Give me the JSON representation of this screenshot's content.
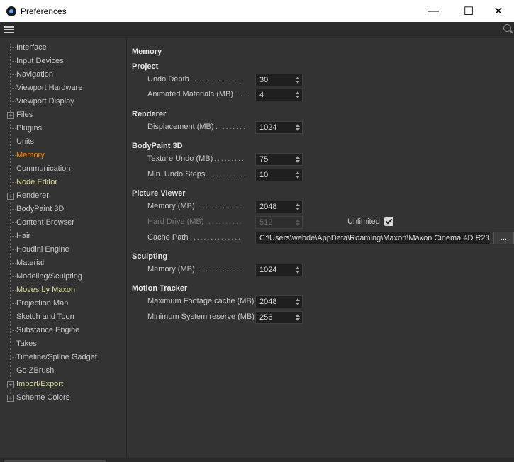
{
  "window": {
    "title": "Preferences",
    "minimize": "—",
    "maximize": "☐",
    "close": "✕"
  },
  "sidebar": {
    "items": [
      {
        "label": "Interface",
        "state": "normal",
        "expandable": false
      },
      {
        "label": "Input Devices",
        "state": "normal",
        "expandable": false
      },
      {
        "label": "Navigation",
        "state": "normal",
        "expandable": false
      },
      {
        "label": "Viewport Hardware",
        "state": "normal",
        "expandable": false
      },
      {
        "label": "Viewport Display",
        "state": "normal",
        "expandable": false
      },
      {
        "label": "Files",
        "state": "normal",
        "expandable": true
      },
      {
        "label": "Plugins",
        "state": "normal",
        "expandable": false
      },
      {
        "label": "Units",
        "state": "normal",
        "expandable": false
      },
      {
        "label": "Memory",
        "state": "active",
        "expandable": false
      },
      {
        "label": "Communication",
        "state": "normal",
        "expandable": false
      },
      {
        "label": "Node Editor",
        "state": "plugin",
        "expandable": false
      },
      {
        "label": "Renderer",
        "state": "normal",
        "expandable": true
      },
      {
        "label": "BodyPaint 3D",
        "state": "normal",
        "expandable": false
      },
      {
        "label": "Content Browser",
        "state": "normal",
        "expandable": false
      },
      {
        "label": "Hair",
        "state": "normal",
        "expandable": false
      },
      {
        "label": "Houdini Engine",
        "state": "normal",
        "expandable": false
      },
      {
        "label": "Material",
        "state": "normal",
        "expandable": false
      },
      {
        "label": "Modeling/Sculpting",
        "state": "normal",
        "expandable": false
      },
      {
        "label": "Moves by Maxon",
        "state": "plugin",
        "expandable": false
      },
      {
        "label": "Projection Man",
        "state": "normal",
        "expandable": false
      },
      {
        "label": "Sketch and Toon",
        "state": "normal",
        "expandable": false
      },
      {
        "label": "Substance Engine",
        "state": "normal",
        "expandable": false
      },
      {
        "label": "Takes",
        "state": "normal",
        "expandable": false
      },
      {
        "label": "Timeline/Spline Gadget",
        "state": "normal",
        "expandable": false
      },
      {
        "label": "Go ZBrush",
        "state": "normal",
        "expandable": false
      },
      {
        "label": "Import/Export",
        "state": "plugin",
        "expandable": true
      },
      {
        "label": "Scheme Colors",
        "state": "normal",
        "expandable": true
      }
    ]
  },
  "main": {
    "page_title": "Memory",
    "sections": {
      "project": {
        "heading": "Project",
        "undo_depth": {
          "label": "Undo Depth",
          "value": "30"
        },
        "animated_materials": {
          "label": "Animated Materials (MB)",
          "value": "4"
        }
      },
      "renderer": {
        "heading": "Renderer",
        "displacement": {
          "label": "Displacement (MB)",
          "value": "1024"
        }
      },
      "bodypaint": {
        "heading": "BodyPaint 3D",
        "texture_undo": {
          "label": "Texture Undo (MB)",
          "value": "75"
        },
        "min_undo_steps": {
          "label": "Min. Undo Steps.",
          "value": "10"
        }
      },
      "picture_viewer": {
        "heading": "Picture Viewer",
        "memory": {
          "label": "Memory (MB)",
          "value": "2048"
        },
        "hard_drive": {
          "label": "Hard Drive (MB)",
          "value": "512"
        },
        "unlimited_label": "Unlimited",
        "unlimited_checked": true,
        "cache_path": {
          "label": "Cache Path",
          "value": "C:\\Users\\webde\\AppData\\Roaming\\Maxon\\Maxon Cinema 4D R23",
          "browse": "..."
        }
      },
      "sculpting": {
        "heading": "Sculpting",
        "memory": {
          "label": "Memory (MB)",
          "value": "1024"
        }
      },
      "motion_tracker": {
        "heading": "Motion Tracker",
        "max_footage": {
          "label": "Maximum Footage cache (MB)",
          "value": "2048"
        },
        "min_system": {
          "label": "Minimum System reserve (MB)",
          "value": "256"
        }
      }
    }
  },
  "colors": {
    "background": "#333333",
    "active_item": "#ff8a00",
    "plugin_item": "#dedea0",
    "field_bg": "#1f1f1f"
  }
}
